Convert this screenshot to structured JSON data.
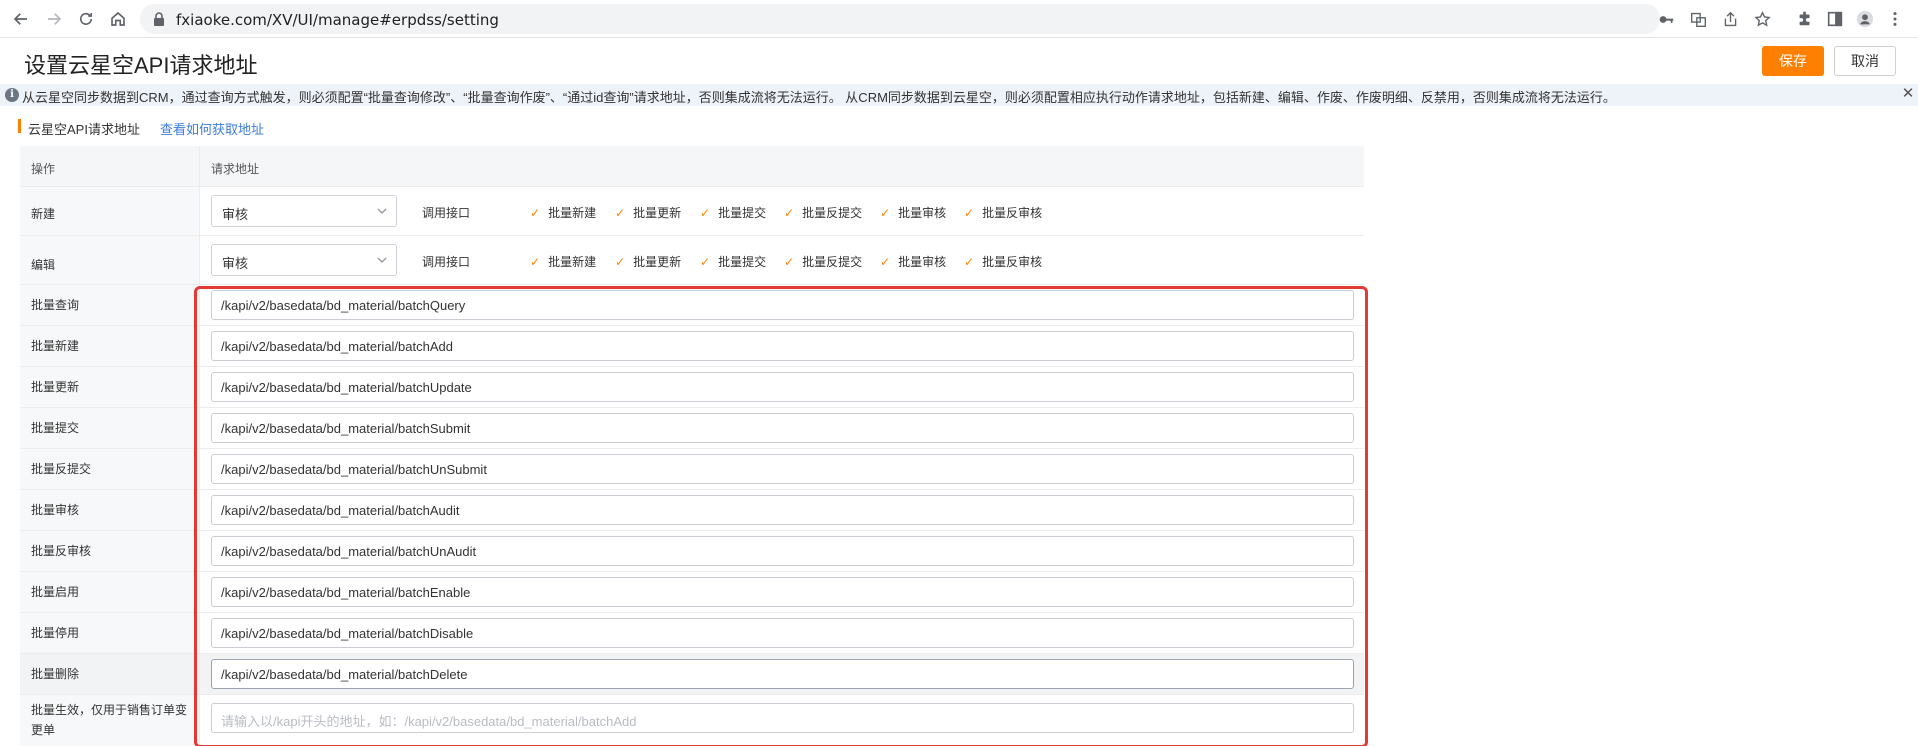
{
  "browser": {
    "url": "fxiaoke.com/XV/UI/manage#erpdss/setting"
  },
  "page": {
    "title": "设置云星空API请求地址",
    "save_label": "保存",
    "cancel_label": "取消"
  },
  "notice": {
    "text": "从云星空同步数据到CRM，通过查询方式触发，则必须配置“批量查询修改”、“批量查询作废”、“通过id查询”请求地址，否则集成流将无法运行。 从CRM同步数据到云星空，则必须配置相应执行动作请求地址，包括新建、编辑、作废、作废明细、反禁用，否则集成流将无法运行。"
  },
  "section": {
    "title": "云星空API请求地址",
    "link": "查看如何获取地址"
  },
  "table": {
    "headers": {
      "operation": "操作",
      "address": "请求地址"
    },
    "select_rows": [
      {
        "op": "新建",
        "select_value": "审核",
        "api_label": "调用接口",
        "checks": [
          "批量新建",
          "批量更新",
          "批量提交",
          "批量反提交",
          "批量审核",
          "批量反审核"
        ]
      },
      {
        "op": "编辑",
        "select_value": "审核",
        "api_label": "调用接口",
        "checks": [
          "批量新建",
          "批量更新",
          "批量提交",
          "批量反提交",
          "批量审核",
          "批量反审核"
        ]
      }
    ],
    "url_rows": [
      {
        "op": "批量查询",
        "value": "/kapi/v2/basedata/bd_material/batchQuery"
      },
      {
        "op": "批量新建",
        "value": "/kapi/v2/basedata/bd_material/batchAdd"
      },
      {
        "op": "批量更新",
        "value": "/kapi/v2/basedata/bd_material/batchUpdate"
      },
      {
        "op": "批量提交",
        "value": "/kapi/v2/basedata/bd_material/batchSubmit"
      },
      {
        "op": "批量反提交",
        "value": "/kapi/v2/basedata/bd_material/batchUnSubmit"
      },
      {
        "op": "批量审核",
        "value": "/kapi/v2/basedata/bd_material/batchAudit"
      },
      {
        "op": "批量反审核",
        "value": "/kapi/v2/basedata/bd_material/batchUnAudit"
      },
      {
        "op": "批量启用",
        "value": "/kapi/v2/basedata/bd_material/batchEnable"
      },
      {
        "op": "批量停用",
        "value": "/kapi/v2/basedata/bd_material/batchDisable"
      },
      {
        "op": "批量删除",
        "value": "/kapi/v2/basedata/bd_material/batchDelete"
      }
    ],
    "last_row": {
      "op_line1": "批量生效，仅用于销售订单变",
      "op_line2": "更单",
      "placeholder": "请输入以/kapi开头的地址，如：/kapi/v2/basedata/bd_material/batchAdd"
    }
  },
  "colors": {
    "accent": "#ff8000",
    "link": "#3b7dda",
    "highlight_frame": "#e53935"
  }
}
